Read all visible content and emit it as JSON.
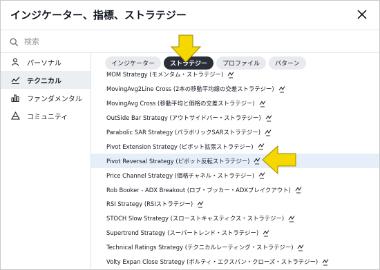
{
  "dialog": {
    "title": "インジケーター、指標、ストラテジー"
  },
  "search": {
    "placeholder": "検索"
  },
  "sidebar": {
    "items": [
      {
        "label": "パーソナル",
        "icon": "person-icon"
      },
      {
        "label": "テクニカル",
        "icon": "chart-line-icon"
      },
      {
        "label": "ファンダメンタル",
        "icon": "bar-chart-icon"
      },
      {
        "label": "コミュニティ",
        "icon": "community-icon"
      }
    ],
    "active": "テクニカル"
  },
  "tabs": [
    {
      "label": "インジケーター"
    },
    {
      "label": "ストラテジー"
    },
    {
      "label": "プロファイル"
    },
    {
      "label": "パターン"
    }
  ],
  "active_tab": "ストラテジー",
  "list": {
    "items": [
      "MOM Strategy (モメンタム・ストラテジー)",
      "MovingAvg2Line Cross (2本の移動平均線の交差ストラテジー)",
      "MovingAvg Cross (移動平均と価格の交差ストラテジー)",
      "OutSide Bar Strategy (アウトサイドバー・ストラテジー)",
      "Parabolic SAR Strategy (パラボリックSARストラテジー)",
      "Pivot Extension Strategy (ピボット拡張ストラテジー)",
      "Pivot Reversal Strategy (ピボット反転ストラテジー)",
      "Price Channel Strategy (価格チャネル・ストラテジー)",
      "Rob Booker - ADX Breakout (ロブ・ブッカー・ADXブレイクアウト)",
      "RSI Strategy (RSIストラテジー)",
      "STOCH Slow Strategy (スローストキャスティクス・ストラテジー)",
      "Supertrend Strategy (スーパートレンド・ストラテジー)",
      "Technical Ratings Strategy (テクニカルレーティング・ストラテジー)",
      "Volty Expan Close Strategy (ボルティ・エクスパン・クローズ・ストラテジー)"
    ],
    "highlighted": "Pivot Reversal Strategy (ピボット反転ストラテジー)"
  },
  "colors": {
    "accent_arrow": "#f5d800",
    "active_tab": "#2a2e39",
    "highlight_row": "#e6eef9"
  }
}
